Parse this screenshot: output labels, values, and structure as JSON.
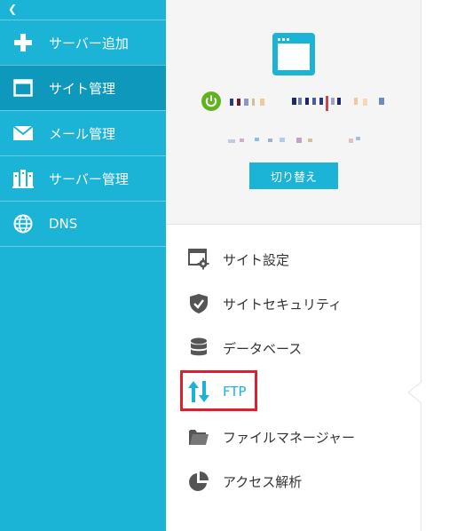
{
  "sidebar": {
    "collapse_glyph": "❮",
    "items": [
      {
        "label": "サーバー追加",
        "icon": "plus-icon"
      },
      {
        "label": "サイト管理",
        "icon": "window-icon",
        "active": true
      },
      {
        "label": "メール管理",
        "icon": "mail-icon"
      },
      {
        "label": "サーバー管理",
        "icon": "server-icon"
      },
      {
        "label": "DNS",
        "icon": "globe-icon"
      }
    ]
  },
  "site_panel": {
    "switch_label": "切り替え",
    "status_color": "#5fb41e"
  },
  "menu": {
    "items": [
      {
        "label": "サイト設定",
        "icon": "site-settings-icon"
      },
      {
        "label": "サイトセキュリティ",
        "icon": "shield-check-icon"
      },
      {
        "label": "データベース",
        "icon": "database-icon"
      },
      {
        "label": "FTP",
        "icon": "transfer-arrows-icon",
        "highlighted": true
      },
      {
        "label": "ファイルマネージャー",
        "icon": "folder-icon"
      },
      {
        "label": "アクセス解析",
        "icon": "pie-chart-icon"
      }
    ]
  },
  "colors": {
    "accent": "#1bb3d6",
    "sidebar_active": "#0e98bb",
    "highlight_border": "#e01e2e"
  }
}
